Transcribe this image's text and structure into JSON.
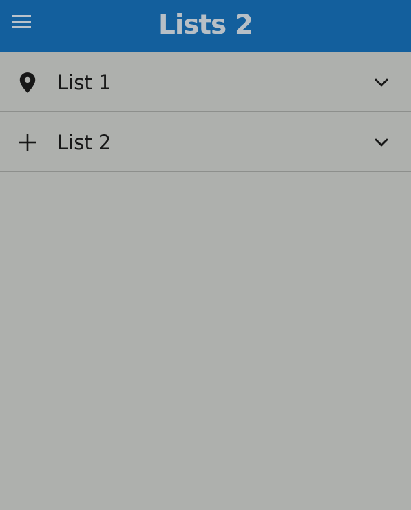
{
  "appbar": {
    "title": "Lists 2",
    "menu_icon": "hamburger-menu-icon",
    "background_color": "#135f9d",
    "title_color": "#b7bfc6"
  },
  "background_color": "#aeb0ad",
  "list": {
    "items": [
      {
        "label": "List 1",
        "icon": "map-pin-icon",
        "expand_icon": "chevron-down-icon"
      },
      {
        "label": "List 2",
        "icon": "plus-icon",
        "expand_icon": "chevron-down-icon"
      }
    ]
  }
}
